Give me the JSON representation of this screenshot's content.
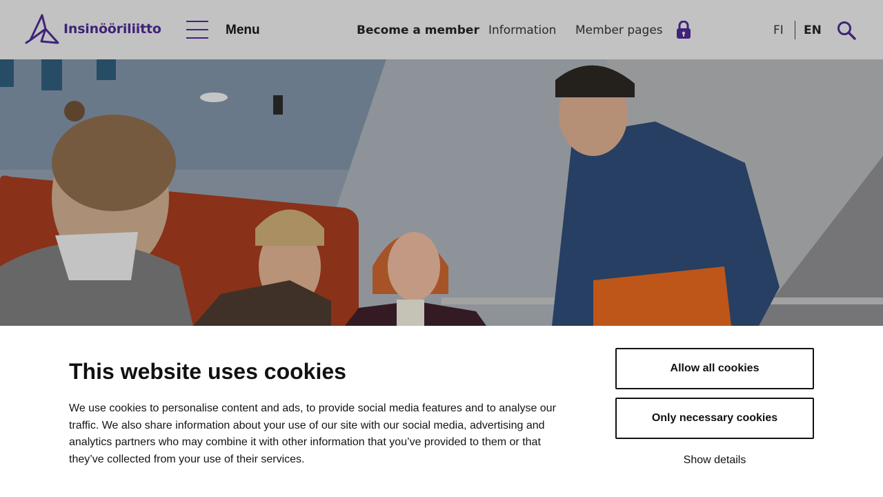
{
  "header": {
    "logo_text": "Insinööriliitto",
    "menu_label": "Menu",
    "nav": {
      "become_member": "Become a member",
      "information": "Information",
      "member_pages": "Member pages"
    },
    "languages": {
      "fi": "FI",
      "en": "EN",
      "active": "EN"
    },
    "icons": [
      "logo-icon",
      "hamburger-icon",
      "lock-icon",
      "search-icon"
    ],
    "colors": {
      "header_bg": "#c2c2c2",
      "brand": "#3f2379"
    }
  },
  "hero": {
    "image": "photo of four people laughing in an office lounge"
  },
  "cookie_banner": {
    "title": "This website uses cookies",
    "text": "We use cookies to personalise content and ads, to provide social media features and to analyse our traffic. We also share information about your use of our site with our social media, advertising and analytics partners who may combine it with other information that you’ve provided to them or that they’ve collected from your use of their services.",
    "allow_all": "Allow all cookies",
    "only_necessary": "Only necessary cookies",
    "show_details": "Show details"
  }
}
